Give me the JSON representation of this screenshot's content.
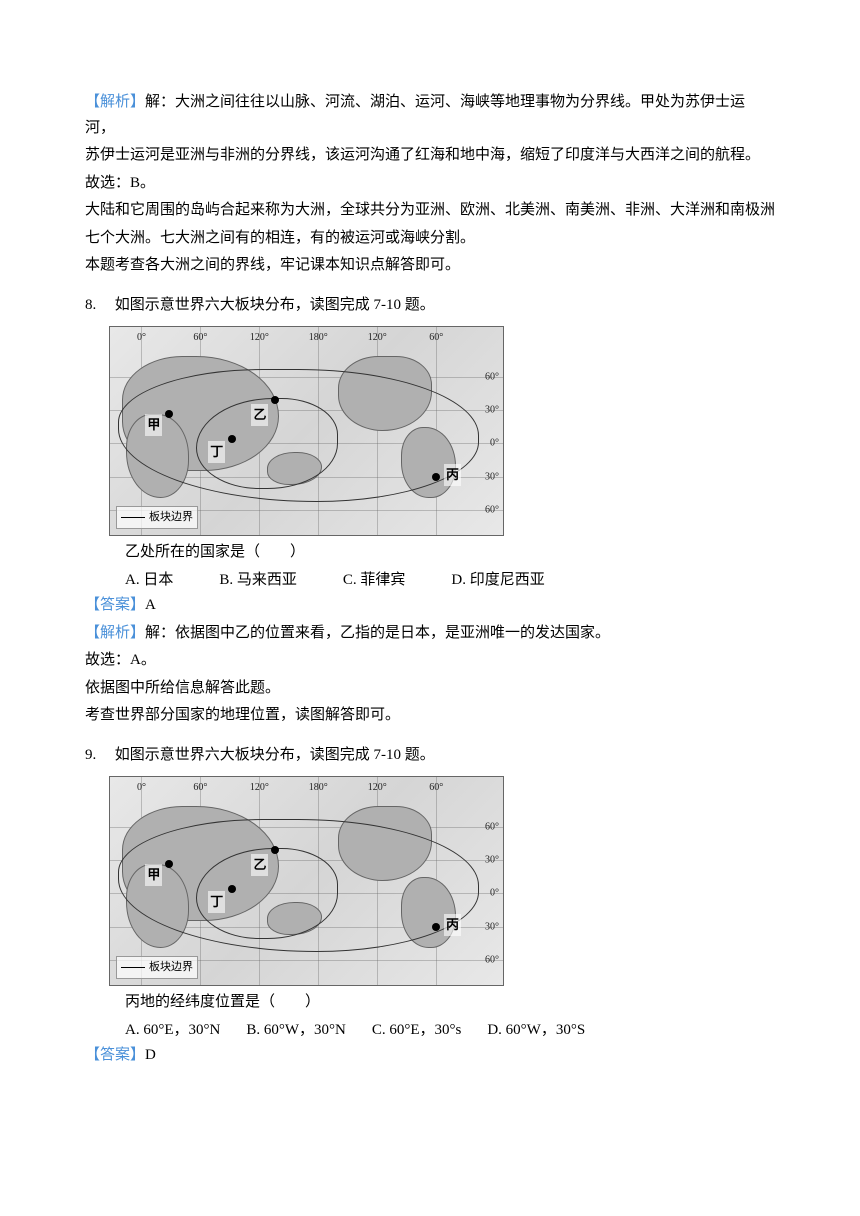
{
  "q7_analysis": {
    "label": "【解析】",
    "line1": "解：大洲之间往往以山脉、河流、湖泊、运河、海峡等地理事物为分界线。甲处为苏伊士运河，",
    "line2": "苏伊士运河是亚洲与非洲的分界线，该运河沟通了红海和地中海，缩短了印度洋与大西洋之间的航程。",
    "line3": "故选：B。",
    "line4": "大陆和它周围的岛屿合起来称为大洲，全球共分为亚洲、欧洲、北美洲、南美洲、非洲、大洋洲和南极洲",
    "line5": "七个大洲。七大洲之间有的相连，有的被运河或海峡分割。",
    "line6": "本题考查各大洲之间的界线，牢记课本知识点解答即可。"
  },
  "map_common": {
    "lon_labels": [
      "0°",
      "60°",
      "120°",
      "180°",
      "120°",
      "60°"
    ],
    "lat_labels": [
      "60°",
      "30°",
      "0°",
      "30°",
      "60°"
    ],
    "legend": "板块边界",
    "point_jia": "甲",
    "point_yi": "乙",
    "point_bing": "丙",
    "point_ding": "丁"
  },
  "q8": {
    "number": "8.",
    "stem": "如图示意世界六大板块分布，读图完成 7-10 题。",
    "question": "乙处所在的国家是（　　）",
    "options": {
      "A": "A. 日本",
      "B": "B. 马来西亚",
      "C": "C. 菲律宾",
      "D": "D. 印度尼西亚"
    },
    "answer_label": "【答案】",
    "answer": "A",
    "analysis_label": "【解析】",
    "analysis_l1": "解：依据图中乙的位置来看，乙指的是日本，是亚洲唯一的发达国家。",
    "analysis_l2": "故选：A。",
    "analysis_l3": "依据图中所给信息解答此题。",
    "analysis_l4": "考查世界部分国家的地理位置，读图解答即可。"
  },
  "q9": {
    "number": "9.",
    "stem": "如图示意世界六大板块分布，读图完成 7-10 题。",
    "question": "丙地的经纬度位置是（　　）",
    "options": {
      "A": "A. 60°E，30°N",
      "B": "B. 60°W，30°N",
      "C": "C. 60°E，30°s",
      "D": "D. 60°W，30°S"
    },
    "answer_label": "【答案】",
    "answer": "D"
  },
  "chart_data": [
    {
      "type": "map",
      "title": "世界六大板块分布",
      "longitude_ticks_deg": [
        0,
        60,
        120,
        180,
        -120,
        -60
      ],
      "latitude_ticks_deg": [
        60,
        30,
        0,
        -30,
        -60
      ],
      "points": [
        {
          "name": "甲",
          "lon": 32,
          "lat": 30,
          "region": "Suez Canal area"
        },
        {
          "name": "乙",
          "lon": 140,
          "lat": 36,
          "region": "Japan"
        },
        {
          "name": "丙",
          "lon": -60,
          "lat": -30,
          "region": "South America east"
        },
        {
          "name": "丁",
          "lon": 95,
          "lat": 5,
          "region": "Southeast Asia"
        }
      ],
      "legend": "板块边界"
    },
    {
      "type": "map",
      "title": "世界六大板块分布",
      "longitude_ticks_deg": [
        0,
        60,
        120,
        180,
        -120,
        -60
      ],
      "latitude_ticks_deg": [
        60,
        30,
        0,
        -30,
        -60
      ],
      "points": [
        {
          "name": "甲",
          "lon": 32,
          "lat": 30,
          "region": "Suez Canal area"
        },
        {
          "name": "乙",
          "lon": 140,
          "lat": 36,
          "region": "Japan"
        },
        {
          "name": "丙",
          "lon": -60,
          "lat": -30,
          "region": "South America east"
        },
        {
          "name": "丁",
          "lon": 95,
          "lat": 5,
          "region": "Southeast Asia"
        }
      ],
      "legend": "板块边界"
    }
  ]
}
